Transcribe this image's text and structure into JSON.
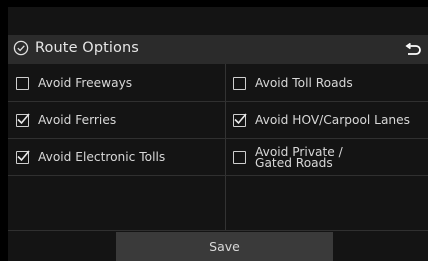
{
  "header": {
    "title": "Route Options",
    "title_icon": "check-circle-icon",
    "back_icon": "return-arrow-icon"
  },
  "options": [
    {
      "label": "Avoid Freeways",
      "checked": false
    },
    {
      "label": "Avoid Toll Roads",
      "checked": false
    },
    {
      "label": "Avoid Ferries",
      "checked": true
    },
    {
      "label": "Avoid HOV/Carpool Lanes",
      "checked": true
    },
    {
      "label": "Avoid Electronic Tolls",
      "checked": true
    },
    {
      "label_line1": "Avoid Private /",
      "label_line2": "Gated Roads",
      "checked": false
    }
  ],
  "save_label": "Save",
  "colors": {
    "background": "#141414",
    "header_bar": "#2b2b2b",
    "button": "#3a3a3a",
    "text": "#d8d8d8"
  }
}
